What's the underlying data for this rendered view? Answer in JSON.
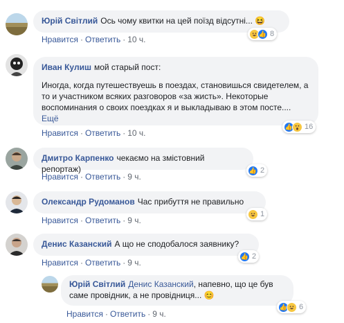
{
  "comments": [
    {
      "author": "Юрій Світлий",
      "text": "Ось чому квитки на цей поїзд відсутні... 😆",
      "like_label": "Нравится",
      "reply_label": "Ответить",
      "time": "10 ч.",
      "reactions": [
        "haha",
        "like"
      ],
      "reaction_count": "8"
    },
    {
      "author": "Иван Кулиш",
      "text_first": "мой старый пост:",
      "text_body": "Иногда, когда путешествуешь в поездах, становишься свидетелем, а то и участником всяких разговоров «за жисть». Некоторые воспоминания о своих поездках я и выкладываю в этом посте....",
      "more_label": "Ещё",
      "like_label": "Нравится",
      "reply_label": "Ответить",
      "time": "10 ч.",
      "reactions": [
        "like",
        "wow"
      ],
      "reaction_count": "16"
    },
    {
      "author": "Дмитро Карпенко",
      "text": "чекаємо на змістовний репортаж)",
      "like_label": "Нравится",
      "reply_label": "Ответить",
      "time": "9 ч.",
      "reactions": [
        "like"
      ],
      "reaction_count": "2"
    },
    {
      "author": "Олександр Рудоманов",
      "text": "Час прибуття не правильно",
      "like_label": "Нравится",
      "reply_label": "Ответить",
      "time": "9 ч.",
      "reactions": [
        "haha"
      ],
      "reaction_count": "1"
    },
    {
      "author": "Денис Казанский",
      "text": "А що не сподобалося заявнику?",
      "like_label": "Нравится",
      "reply_label": "Ответить",
      "time": "9 ч.",
      "reactions": [
        "like"
      ],
      "reaction_count": "2"
    }
  ],
  "reply": {
    "author": "Юрій Світлий",
    "mention": "Денис Казанский",
    "text": ", напевно, що це був саме провідник, а не провідниця... 😊",
    "like_label": "Нравится",
    "reply_label": "Ответить",
    "time": "9 ч.",
    "reactions": [
      "like",
      "haha"
    ],
    "reaction_count": "6"
  },
  "colors": {
    "link": "#385898",
    "bubble": "#f2f3f5",
    "meta": "#616770",
    "like": "#2078f4",
    "haha": "#f7c740"
  }
}
